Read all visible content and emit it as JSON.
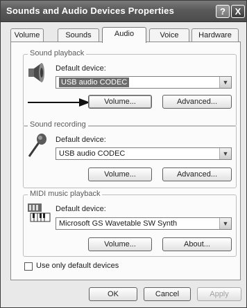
{
  "window": {
    "title": "Sounds and Audio Devices Properties",
    "help_glyph": "?",
    "close_glyph": "X"
  },
  "tabs": [
    {
      "label": "Volume",
      "active": false
    },
    {
      "label": "Sounds",
      "active": false
    },
    {
      "label": "Audio",
      "active": true
    },
    {
      "label": "Voice",
      "active": false
    },
    {
      "label": "Hardware",
      "active": false
    }
  ],
  "sound_playback": {
    "group_label": "Sound playback",
    "device_label": "Default device:",
    "device_value": "USB audio CODEC",
    "volume_button": "Volume...",
    "advanced_button": "Advanced...",
    "icon": "speaker-icon"
  },
  "sound_recording": {
    "group_label": "Sound recording",
    "device_label": "Default device:",
    "device_value": "USB audio CODEC",
    "volume_button": "Volume...",
    "advanced_button": "Advanced...",
    "icon": "microphone-icon"
  },
  "midi_playback": {
    "group_label": "MIDI music playback",
    "device_label": "Default device:",
    "device_value": "Microsoft GS Wavetable SW Synth",
    "volume_button": "Volume...",
    "about_button": "About...",
    "icon": "keyboard-icon"
  },
  "options": {
    "default_devices_label": "Use only default devices",
    "default_devices_checked": false
  },
  "footer": {
    "ok": "OK",
    "cancel": "Cancel",
    "apply": "Apply"
  },
  "dropdown_glyph": "▼"
}
